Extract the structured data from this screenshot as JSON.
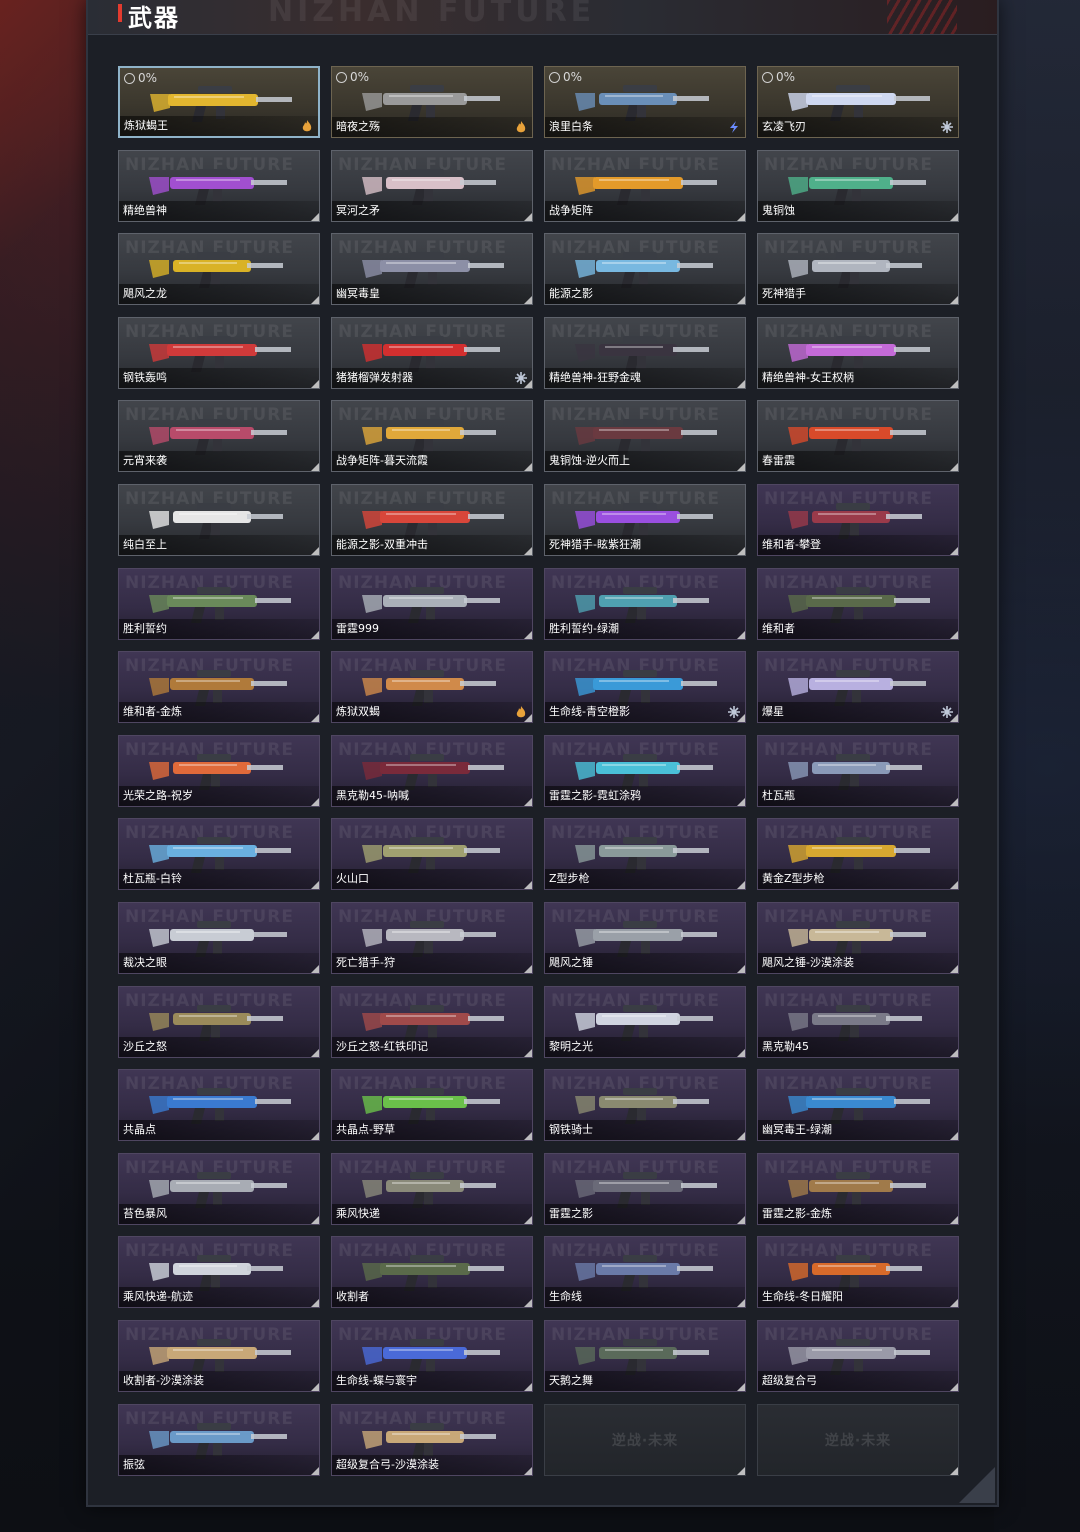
{
  "panel": {
    "title": "武器",
    "header_watermark": "NIZHAN FUTURE",
    "card_watermark": "NIZHAN FUTURE",
    "empty_logo": "逆战·未来"
  },
  "colors": {
    "accent": "#e23b2f",
    "gold_card": "#3b372d",
    "white_card": "#36393f",
    "purple_card": "#342c46",
    "fire_badge": "#e8a23a",
    "electric_badge": "#6b8cff",
    "ice_badge": "#bfc8d8"
  },
  "weapons": [
    {
      "name": "炼狱蝎王",
      "tier": "gold",
      "progress": "0%",
      "badge": "fire-icon",
      "selected": true,
      "gun_color": "#e2b62f"
    },
    {
      "name": "暗夜之殇",
      "tier": "gold",
      "progress": "0%",
      "badge": "fire-icon",
      "gun_color": "#9a9a9a"
    },
    {
      "name": "浪里白条",
      "tier": "gold",
      "progress": "0%",
      "badge": "electric-icon",
      "gun_color": "#6a8fb8"
    },
    {
      "name": "玄凌飞刃",
      "tier": "gold",
      "progress": "0%",
      "badge": "ice-icon",
      "gun_color": "#cfd8f0"
    },
    {
      "name": "精绝兽神",
      "tier": "white",
      "gun_color": "#a14fd0"
    },
    {
      "name": "冥河之矛",
      "tier": "white",
      "gun_color": "#d8c0c8"
    },
    {
      "name": "战争矩阵",
      "tier": "white",
      "gun_color": "#e39a2a"
    },
    {
      "name": "鬼铜蚀",
      "tier": "white",
      "gun_color": "#4fb08a"
    },
    {
      "name": "飓风之龙",
      "tier": "white",
      "gun_color": "#d9b226"
    },
    {
      "name": "幽冥毒皇",
      "tier": "white",
      "gun_color": "#8c8fa6"
    },
    {
      "name": "能源之影",
      "tier": "white",
      "gun_color": "#78b8e0"
    },
    {
      "name": "死神猎手",
      "tier": "white",
      "gun_color": "#b0b5bf"
    },
    {
      "name": "钢铁轰鸣",
      "tier": "white",
      "gun_color": "#d03a3a"
    },
    {
      "name": "猪猪榴弹发射器",
      "tier": "white",
      "badge": "ice-icon",
      "gun_color": "#d32f2f"
    },
    {
      "name": "精绝兽神-狂野金魂",
      "tier": "white",
      "gun_color": "#3a3440"
    },
    {
      "name": "精绝兽神-女王权柄",
      "tier": "white",
      "gun_color": "#c46ad8"
    },
    {
      "name": "元宵来袭",
      "tier": "white",
      "gun_color": "#b84b6a"
    },
    {
      "name": "战争矩阵-暮天流霞",
      "tier": "white",
      "gun_color": "#e0a83a"
    },
    {
      "name": "鬼铜蚀-逆火而上",
      "tier": "white",
      "gun_color": "#6a3a40"
    },
    {
      "name": "春雷震",
      "tier": "white",
      "gun_color": "#d84a2a"
    },
    {
      "name": "纯白至上",
      "tier": "white",
      "gun_color": "#e6e6e6"
    },
    {
      "name": "能源之影-双重冲击",
      "tier": "white",
      "gun_color": "#d8463a"
    },
    {
      "name": "死神猎手-眩紫狂潮",
      "tier": "white",
      "gun_color": "#9a4fe0"
    },
    {
      "name": "维和者-攀登",
      "tier": "purple",
      "gun_color": "#9a3a4a"
    },
    {
      "name": "胜利誓约",
      "tier": "purple",
      "gun_color": "#6a8a5a"
    },
    {
      "name": "雷霆999",
      "tier": "purple",
      "gun_color": "#aab0b8"
    },
    {
      "name": "胜利誓约-绿潮",
      "tier": "purple",
      "gun_color": "#4fa0b0"
    },
    {
      "name": "维和者",
      "tier": "purple",
      "gun_color": "#5a6a4a"
    },
    {
      "name": "维和者-金炼",
      "tier": "purple",
      "gun_color": "#b07a3a"
    },
    {
      "name": "炼狱双蝎",
      "tier": "purple",
      "badge": "fire-icon",
      "gun_color": "#d08a4a"
    },
    {
      "name": "生命线-青空橙影",
      "tier": "purple",
      "badge": "ice-icon",
      "gun_color": "#3a9ad8"
    },
    {
      "name": "爆星",
      "tier": "purple",
      "badge": "ice-icon",
      "gun_color": "#b8b0e0"
    },
    {
      "name": "光荣之路-祝岁",
      "tier": "purple",
      "gun_color": "#e06a3a"
    },
    {
      "name": "黑克勒45-呐喊",
      "tier": "purple",
      "gun_color": "#7a2a3a"
    },
    {
      "name": "雷霆之影-霓虹涂鸦",
      "tier": "purple",
      "gun_color": "#4ac0d8"
    },
    {
      "name": "杜瓦瓶",
      "tier": "purple",
      "gun_color": "#8a9ab8"
    },
    {
      "name": "杜瓦瓶-白铃",
      "tier": "purple",
      "gun_color": "#6ab0e0"
    },
    {
      "name": "火山口",
      "tier": "purple",
      "gun_color": "#a0a070"
    },
    {
      "name": "Z型步枪",
      "tier": "purple",
      "gun_color": "#8a9a9a"
    },
    {
      "name": "黄金Z型步枪",
      "tier": "purple",
      "gun_color": "#d8a830"
    },
    {
      "name": "裁决之眼",
      "tier": "purple",
      "gun_color": "#c8ccd4"
    },
    {
      "name": "死亡猎手-狩",
      "tier": "purple",
      "gun_color": "#b8b8c0"
    },
    {
      "name": "飓风之锤",
      "tier": "purple",
      "gun_color": "#9aa0a8"
    },
    {
      "name": "飓风之锤-沙漠涂装",
      "tier": "purple",
      "gun_color": "#c8b898"
    },
    {
      "name": "沙丘之怒",
      "tier": "purple",
      "gun_color": "#9a8a5a"
    },
    {
      "name": "沙丘之怒-红铁印记",
      "tier": "purple",
      "gun_color": "#a04a4a"
    },
    {
      "name": "黎明之光",
      "tier": "purple",
      "gun_color": "#d0d4e0"
    },
    {
      "name": "黑克勒45",
      "tier": "purple",
      "gun_color": "#7a7a88"
    },
    {
      "name": "共晶点",
      "tier": "purple",
      "gun_color": "#3a7ad0"
    },
    {
      "name": "共晶点-野草",
      "tier": "purple",
      "gun_color": "#6ac04a"
    },
    {
      "name": "钢铁骑士",
      "tier": "purple",
      "gun_color": "#8a8a70"
    },
    {
      "name": "幽冥毒王-绿潮",
      "tier": "purple",
      "gun_color": "#3a8ad0"
    },
    {
      "name": "苔色暴风",
      "tier": "purple",
      "gun_color": "#a8acb4"
    },
    {
      "name": "乘风快递",
      "tier": "purple",
      "gun_color": "#8a8a7a"
    },
    {
      "name": "雷霆之影",
      "tier": "purple",
      "gun_color": "#6a6a78"
    },
    {
      "name": "雷霆之影-金炼",
      "tier": "purple",
      "gun_color": "#a07a4a"
    },
    {
      "name": "乘风快递-航迹",
      "tier": "purple",
      "gun_color": "#d0d4dc"
    },
    {
      "name": "收割者",
      "tier": "purple",
      "gun_color": "#5a6a4a"
    },
    {
      "name": "生命线",
      "tier": "purple",
      "gun_color": "#6a7aa8"
    },
    {
      "name": "生命线-冬日耀阳",
      "tier": "purple",
      "gun_color": "#d86a2a"
    },
    {
      "name": "收割者-沙漠涂装",
      "tier": "purple",
      "gun_color": "#c8a878"
    },
    {
      "name": "生命线-蝶与寰宇",
      "tier": "purple",
      "gun_color": "#4a6ad8"
    },
    {
      "name": "天鹅之舞",
      "tier": "purple",
      "gun_color": "#5a6a5a"
    },
    {
      "name": "超级复合弓",
      "tier": "purple",
      "gun_color": "#9a9aa8"
    },
    {
      "name": "振弦",
      "tier": "purple",
      "gun_color": "#6a9ac8"
    },
    {
      "name": "超级复合弓-沙漠涂装",
      "tier": "purple",
      "gun_color": "#c8a878"
    },
    {
      "name": "",
      "tier": "empty"
    },
    {
      "name": "",
      "tier": "empty"
    }
  ]
}
